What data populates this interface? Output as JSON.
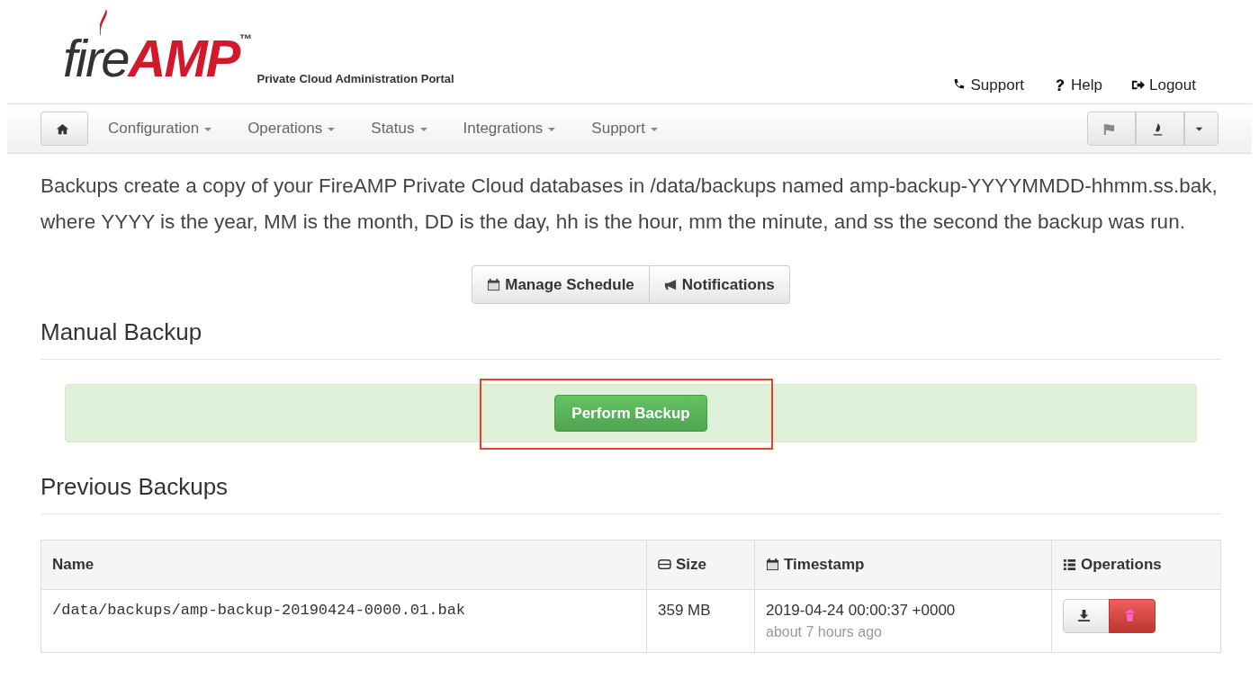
{
  "header": {
    "logo": {
      "prefix": "fire",
      "accent": "AMP",
      "mark": "™"
    },
    "subtitle": "Private Cloud Administration Portal",
    "links": [
      "Support",
      "Help",
      "Logout"
    ]
  },
  "navbar": {
    "menus": [
      "Configuration",
      "Operations",
      "Status",
      "Integrations",
      "Support"
    ]
  },
  "intro": "Backups create a copy of your FireAMP Private Cloud databases in /data/backups named amp-backup-YYYYMMDD-hhmm.ss.bak, where YYYY is the year, MM is the month, DD is the day, hh is the hour, mm the minute, and ss the second the backup was run.",
  "actions": [
    "Manage Schedule",
    "Notifications"
  ],
  "manual": {
    "heading": "Manual Backup",
    "button": "Perform Backup",
    "highlighted": true
  },
  "previous": {
    "heading": "Previous Backups",
    "columns": [
      "Name",
      "Size",
      "Timestamp",
      "Operations"
    ],
    "rows": [
      {
        "name": "/data/backups/amp-backup-20190424-0000.01.bak",
        "size": "359 MB",
        "timestamp": "2019-04-24 00:00:37 +0000",
        "relative": "about 7 hours ago"
      }
    ]
  }
}
